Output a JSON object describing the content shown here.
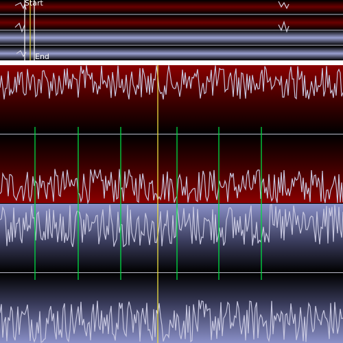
{
  "overview": {
    "start_label": "Start",
    "end_label": "End",
    "panel_color": "#101018",
    "red_band_color": "#5a0000",
    "blue_band_color": "#8088b8"
  },
  "main": {
    "playhead_color": "#f0e040",
    "beat_marker_color": "#00dd44",
    "waveform_color": "#c8c8e0",
    "red_track_color": "#7a0000",
    "blue_track_color": "#8a90c8",
    "centerline_color": "#c0c0d0"
  },
  "beat_markers": [
    {
      "name": "beat-1"
    },
    {
      "name": "beat-2"
    },
    {
      "name": "beat-3"
    },
    {
      "name": "beat-4"
    },
    {
      "name": "beat-5"
    },
    {
      "name": "beat-6"
    }
  ]
}
